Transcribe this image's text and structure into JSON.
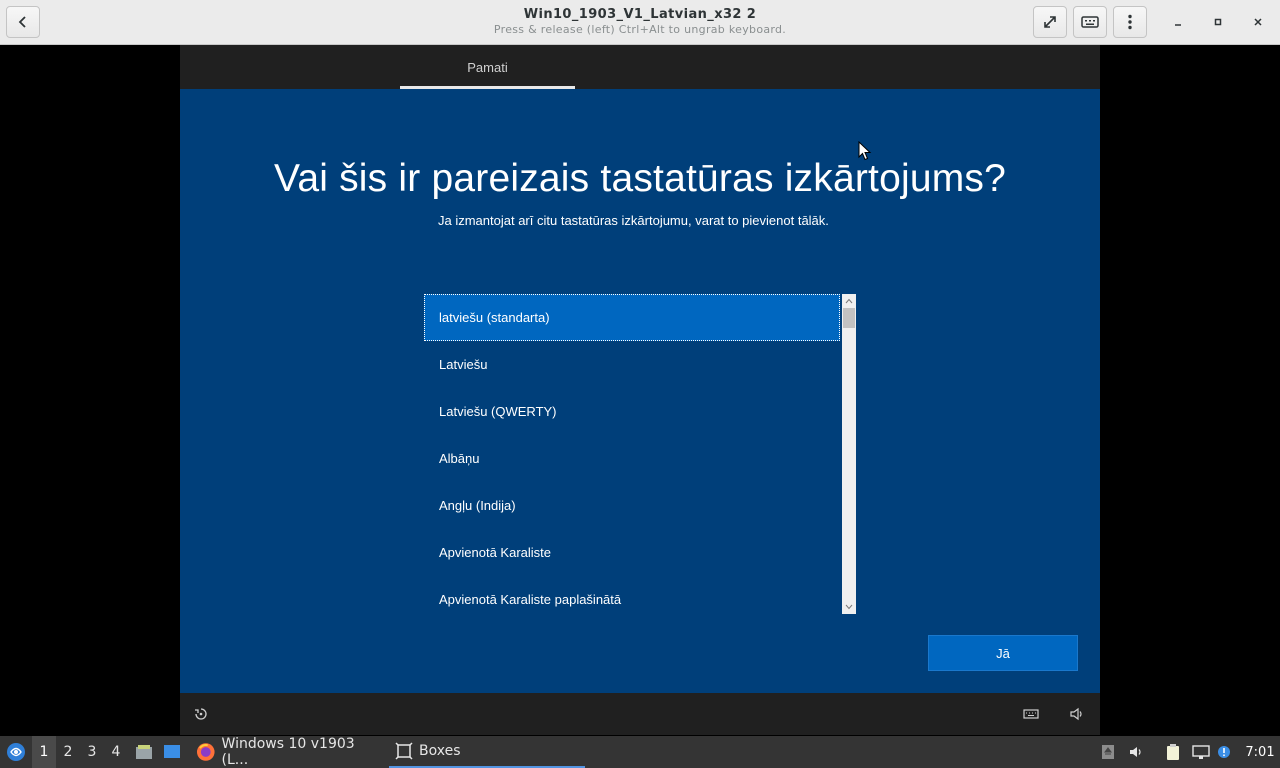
{
  "window": {
    "title": "Win10_1903_V1_Latvian_x32 2",
    "subtitle": "Press & release (left) Ctrl+Alt to ungrab keyboard."
  },
  "icons": {
    "back": "chevron-left-icon",
    "fullscreen": "fullscreen-icon",
    "keyboard": "keyboard-icon",
    "menu": "kebab-menu-icon",
    "minimize": "minimize-icon",
    "maximize": "maximize-icon",
    "close": "close-icon"
  },
  "vm": {
    "tabs": [
      {
        "label": "Pamati",
        "active": true
      }
    ],
    "heading": "Vai šis ir pareizais tastatūras izkārtojums?",
    "subheading": "Ja izmantojat arī citu tastatūras izkārtojumu, varat to pievienot tālāk.",
    "layouts": [
      {
        "label": "latviešu (standarta)",
        "selected": true
      },
      {
        "label": "Latviešu"
      },
      {
        "label": "Latviešu (QWERTY)"
      },
      {
        "label": "Albāņu"
      },
      {
        "label": "Angļu (Indija)"
      },
      {
        "label": "Apvienotā Karaliste"
      },
      {
        "label": "Apvienotā Karaliste paplašinātā"
      }
    ],
    "confirm_label": "Jā",
    "colors": {
      "background": "#003f7a",
      "accent": "#0067c0",
      "bar": "#202020"
    }
  },
  "taskbar": {
    "workspaces": [
      "1",
      "2",
      "3",
      "4"
    ],
    "active_workspace": "1",
    "tasks": [
      {
        "label": "Windows 10 v1903 (L...",
        "icon": "firefox-icon"
      },
      {
        "label": "Boxes",
        "icon": "boxes-icon",
        "active": true
      }
    ],
    "clock": "7:01"
  }
}
